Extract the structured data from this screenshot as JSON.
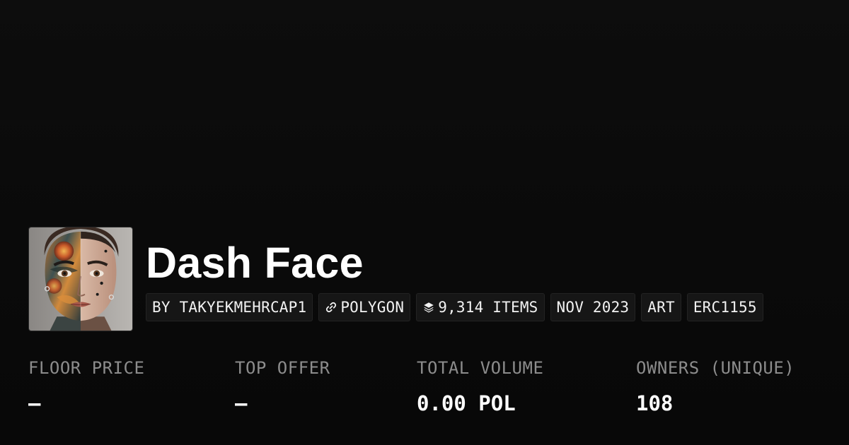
{
  "collection": {
    "name": "Dash Face",
    "avatar_icon": "tattooed-face-portrait"
  },
  "tags": [
    {
      "label": "BY TAKYEKMEHRCAP1",
      "icon": ""
    },
    {
      "label": "POLYGON",
      "icon": "link-chain-icon"
    },
    {
      "label": "9,314 ITEMS",
      "icon": "layers-icon"
    },
    {
      "label": "NOV 2023",
      "icon": ""
    },
    {
      "label": "ART",
      "icon": ""
    },
    {
      "label": "ERC1155",
      "icon": ""
    }
  ],
  "stats": [
    {
      "label": "FLOOR PRICE",
      "value": "–"
    },
    {
      "label": "TOP OFFER",
      "value": "–"
    },
    {
      "label": "TOTAL VOLUME",
      "value": "0.00 POL"
    },
    {
      "label": "OWNERS (UNIQUE)",
      "value": "108"
    }
  ],
  "colors": {
    "background": "#0a0a0a",
    "tag_background": "#161616",
    "label_gray": "#8c8c8c",
    "text_white": "#ffffff"
  }
}
